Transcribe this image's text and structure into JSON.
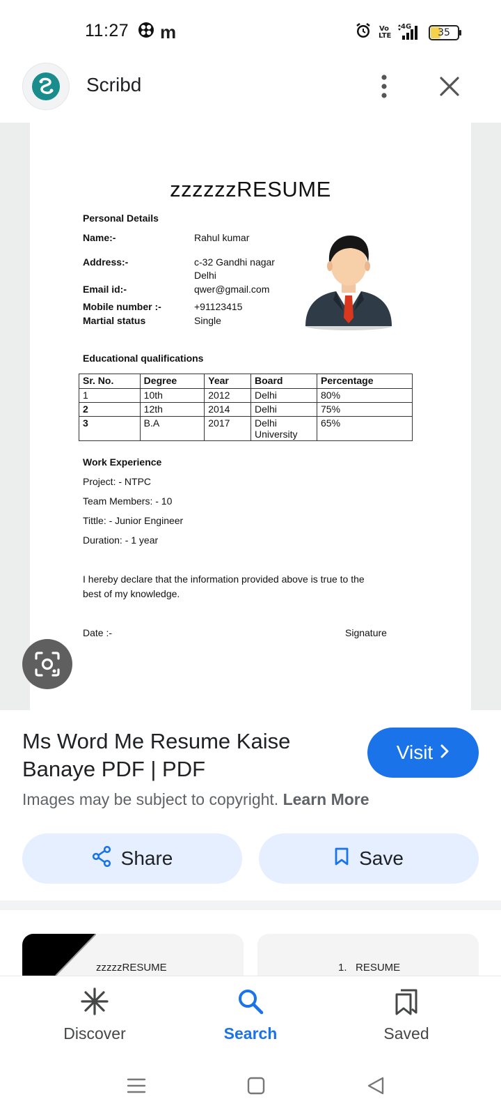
{
  "status_bar": {
    "time": "11:27",
    "app_icons": [
      "clover-icon",
      "m-icon"
    ],
    "m_glyph": "m",
    "volte": "Vo LTE",
    "network": "4G",
    "battery": "35",
    "battery_level_percent": 35
  },
  "header": {
    "site_name": "Scribd",
    "brand_color": "#1a8c8c"
  },
  "document": {
    "title": "zzzzzzRESUME",
    "personal_details_heading": "Personal Details",
    "name_label": "Name:-",
    "name_value": "Rahul kumar",
    "address_label": "Address:-",
    "address_line1": "c-32 Gandhi nagar",
    "address_line2": "Delhi",
    "email_label": "Email id:-",
    "email_value": "qwer@gmail.com",
    "mobile_label": "Mobile number :-",
    "mobile_value": "+91123415",
    "marital_label": "Martial status",
    "marital_value": "Single",
    "education_heading": "Educational qualifications",
    "table_headers": [
      "Sr. No.",
      "Degree",
      "Year",
      "Board",
      "Percentage"
    ],
    "table_rows": [
      [
        "1",
        "10th",
        "2012",
        "Delhi",
        "80%"
      ],
      [
        "2",
        "12th",
        "2014",
        "Delhi",
        "75%"
      ],
      [
        "3",
        "B.A",
        "2017",
        "Delhi University",
        "65%"
      ]
    ],
    "work_heading": "Work Experience",
    "project": "Project: - NTPC",
    "team_members": "Team Members: - 10",
    "tittle": "Tittle: - Junior Engineer",
    "duration": "Duration: - 1 year",
    "declaration_line1": "I hereby declare that the information provided above is true to the",
    "declaration_line2": "best of my knowledge.",
    "date_label": "Date :-",
    "signature_label": "Signature"
  },
  "result": {
    "title": "Ms Word Me Resume Kaise Banaye PDF | PDF",
    "visit_label": "Visit",
    "copyright_text": "Images may be subject to copyright.",
    "learn_more": "Learn More",
    "share_label": "Share",
    "save_label": "Save",
    "accent_color": "#1a73e8"
  },
  "related": {
    "thumb1_text": "zzzzzRESUME",
    "thumb2_text": "1.   RESUME"
  },
  "bottom_nav": {
    "discover": "Discover",
    "search": "Search",
    "saved": "Saved",
    "active": "search"
  }
}
